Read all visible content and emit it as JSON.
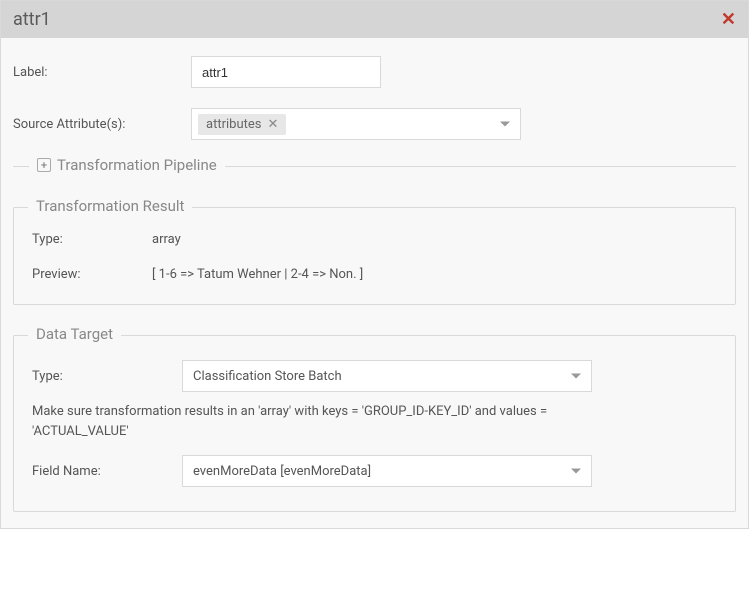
{
  "header": {
    "title": "attr1",
    "close_icon": "✕"
  },
  "form": {
    "label_label": "Label:",
    "label_value": "attr1",
    "source_label": "Source Attribute(s):",
    "source_tag": "attributes",
    "source_tag_remove": "✕"
  },
  "pipeline": {
    "legend": "Transformation Pipeline",
    "plus": "+"
  },
  "result": {
    "legend": "Transformation Result",
    "type_label": "Type:",
    "type_value": "array",
    "preview_label": "Preview:",
    "preview_value": "[ 1-6 => Tatum Wehner | 2-4 => Non. ]"
  },
  "target": {
    "legend": "Data Target",
    "type_label": "Type:",
    "type_value": "Classification Store Batch",
    "hint": "Make sure transformation results in an 'array' with keys = 'GROUP_ID-KEY_ID' and values = 'ACTUAL_VALUE'",
    "fieldname_label": "Field Name:",
    "fieldname_value": "evenMoreData [evenMoreData]"
  }
}
